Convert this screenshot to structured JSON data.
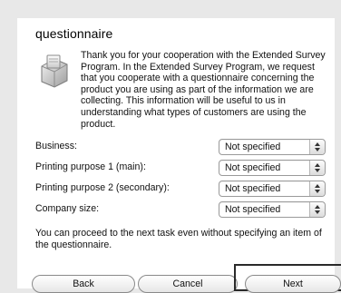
{
  "title": "questionnaire",
  "intro_text": "Thank you for your cooperation with the Extended Survey Program. In the Extended Survey Program, we request that you cooperate with a questionnaire concerning the product you are using as part of the information we are collecting. This information will be useful to us in understanding what types of customers are using the product.",
  "fields": [
    {
      "label": "Business:",
      "value": "Not specified"
    },
    {
      "label": "Printing purpose 1 (main):",
      "value": "Not specified"
    },
    {
      "label": "Printing purpose 2 (secondary):",
      "value": "Not specified"
    },
    {
      "label": "Company size:",
      "value": "Not specified"
    }
  ],
  "note_text": "You can proceed to the next task even without specifying an item of the questionnaire.",
  "buttons": {
    "back": "Back",
    "cancel": "Cancel",
    "next": "Next"
  },
  "icon": "application-icon"
}
